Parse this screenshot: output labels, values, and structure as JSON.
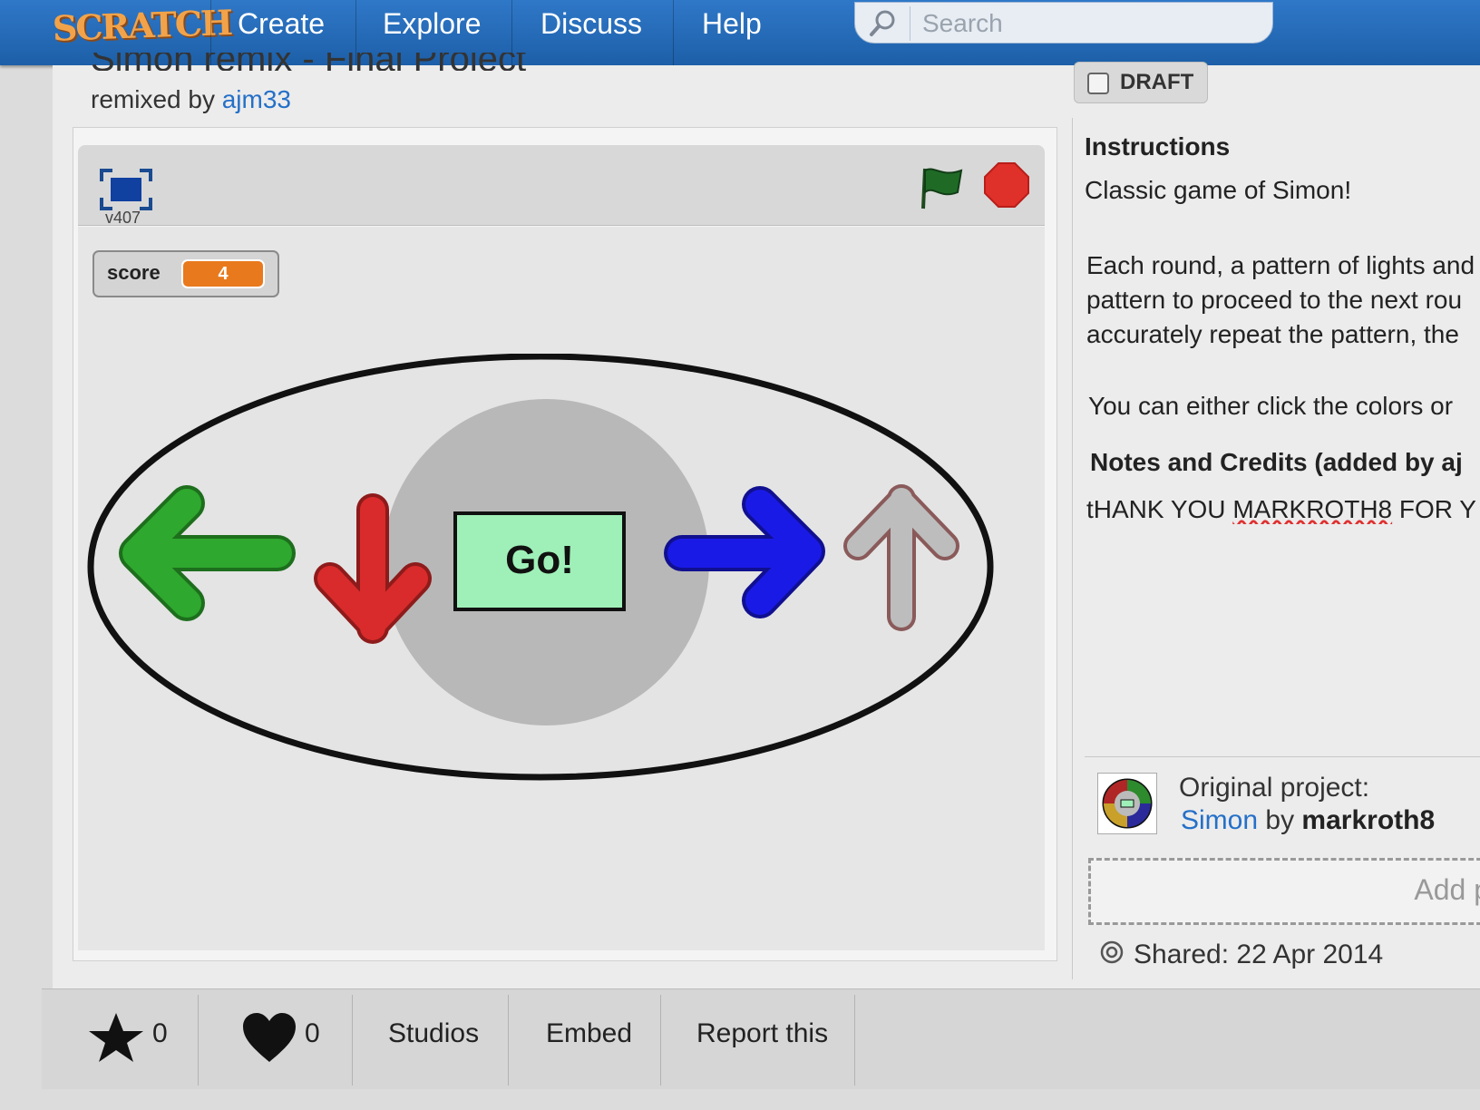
{
  "nav": {
    "logo": "SCRATCH",
    "items": [
      "Create",
      "Explore",
      "Discuss",
      "Help"
    ],
    "search_placeholder": "Search"
  },
  "project": {
    "title_partial": "Simon remix - Final Project",
    "remixed_by_prefix": "remixed by",
    "author": "ajm33",
    "draft_label": "DRAFT"
  },
  "player": {
    "version": "v407",
    "monitor_label": "score",
    "monitor_value": "4",
    "go_label": "Go!"
  },
  "sidebar": {
    "instructions_heading": "Instructions",
    "instructions_line1": "Classic game of Simon!",
    "instructions_para2": [
      "Each round, a pattern of lights and",
      "pattern to proceed to the next rou",
      "accurately repeat the pattern, the"
    ],
    "instructions_line3": "You can either click the colors or",
    "notes_heading": "Notes and Credits (added by aj",
    "notes_text_a": "tHANK YOU ",
    "notes_text_b": "MARKROTH8",
    "notes_text_c": " FOR Y",
    "original_label": "Original project:",
    "original_title": "Simon",
    "original_by": "by",
    "original_author": "markroth8",
    "add_label": "Add p",
    "shared_label": "Shared: 22 Apr 2014"
  },
  "actions": {
    "favorites_count": "0",
    "loves_count": "0",
    "studios": "Studios",
    "embed": "Embed",
    "report": "Report this"
  },
  "colors": {
    "nav_blue": "#2570c8",
    "arrow_left": "#2ea82e",
    "arrow_down": "#d92b2b",
    "arrow_right": "#1a1ae6",
    "arrow_up": "#b8b8b8",
    "go_button": "#9ff0b8",
    "score_orange": "#e8791d",
    "stop_red": "#e0302a"
  }
}
